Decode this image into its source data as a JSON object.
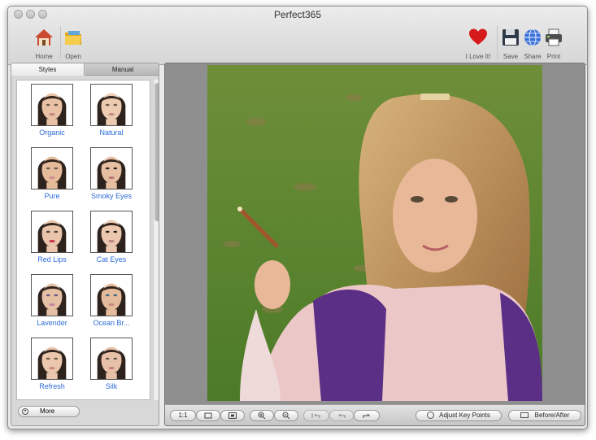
{
  "window": {
    "title": "Perfect365"
  },
  "toolbar": {
    "left": [
      {
        "label": "Home",
        "icon": "home-icon"
      },
      {
        "label": "Open",
        "icon": "folder-icon"
      }
    ],
    "right": [
      {
        "label": "I Love It!",
        "icon": "heart-icon"
      },
      {
        "label": "Save",
        "icon": "floppy-disk-icon"
      },
      {
        "label": "Share",
        "icon": "globe-icon"
      },
      {
        "label": "Print",
        "icon": "printer-icon"
      }
    ]
  },
  "sidebar": {
    "tabs": [
      {
        "label": "Styles",
        "active": true
      },
      {
        "label": "Manual",
        "active": false
      }
    ],
    "styles": [
      {
        "name": "Organic"
      },
      {
        "name": "Natural"
      },
      {
        "name": "Pure"
      },
      {
        "name": "Smoky Eyes"
      },
      {
        "name": "Red Lips"
      },
      {
        "name": "Cat Eyes"
      },
      {
        "name": "Lavender"
      },
      {
        "name": "Ocean Br..."
      },
      {
        "name": "Refresh"
      },
      {
        "name": "Silk"
      }
    ],
    "more_label": "More"
  },
  "viewer": {
    "bottom_bar": {
      "zoom_actual": "1:1",
      "adjust_label": "Adjust Key Points",
      "before_after_label": "Before/After"
    }
  },
  "colors": {
    "link": "#2c6bd8",
    "panel": "#d8d8d8",
    "viewer_bg": "#8f8f8f"
  }
}
